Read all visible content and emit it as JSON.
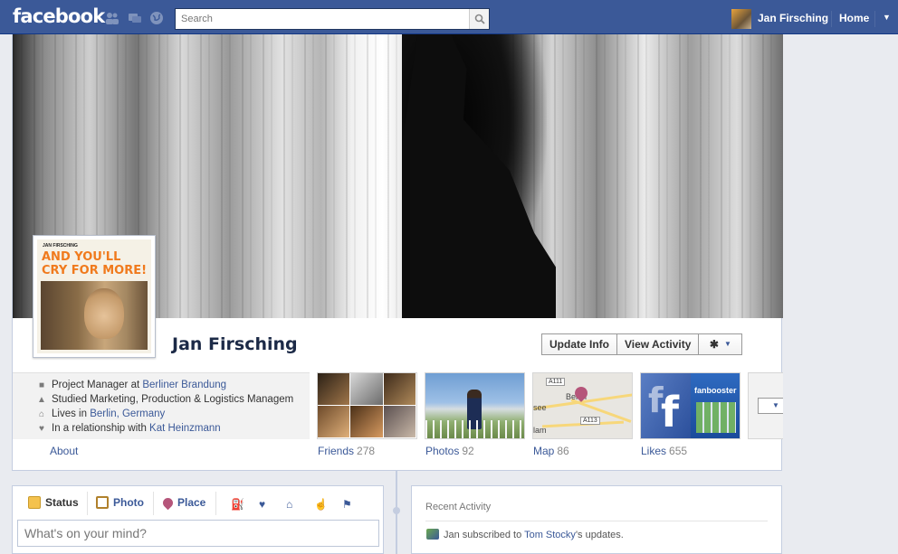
{
  "topbar": {
    "logo": "facebook",
    "search_placeholder": "Search",
    "user_name": "Jan Firsching",
    "home_label": "Home",
    "icons": [
      "friend-requests-icon",
      "messages-icon",
      "notifications-globe-icon",
      "search-icon",
      "account-caret-icon"
    ]
  },
  "profile": {
    "name": "Jan Firsching",
    "picture_text_small": "JAN FIRSCHING",
    "picture_text_big": "AND YOU'LL CRY FOR MORE!",
    "actions": {
      "update_info": "Update Info",
      "view_activity": "View Activity",
      "gear": "✱"
    }
  },
  "about": {
    "lines": [
      {
        "prefix": "Project Manager at ",
        "link": "Berliner Brandung",
        "suffix": "",
        "icon": "briefcase-icon"
      },
      {
        "prefix": "Studied Marketing, Production & Logistics Managem",
        "link": "",
        "suffix": "",
        "icon": "school-icon"
      },
      {
        "prefix": "Lives in ",
        "link": "Berlin, Germany",
        "suffix": "",
        "icon": "home-icon"
      },
      {
        "prefix": "In a relationship with ",
        "link": "Kat Heinzmann",
        "suffix": "",
        "icon": "heart-icon"
      }
    ],
    "about_link": "About"
  },
  "tiles": {
    "friends": {
      "label": "Friends",
      "count": "278"
    },
    "photos": {
      "label": "Photos",
      "count": "92"
    },
    "map": {
      "label": "Map",
      "count": "86",
      "labels": [
        "A111",
        "Berlin",
        "see",
        "A113",
        "lam"
      ]
    },
    "likes": {
      "label": "Likes",
      "count": "655",
      "fan_text": "fanbooster"
    }
  },
  "composer": {
    "tabs": [
      "Status",
      "Photo",
      "Place"
    ],
    "extra_icons": [
      "life-event-icon",
      "heart-small-icon",
      "home-small-icon",
      "hand-icon",
      "flag-icon"
    ],
    "placeholder": "What's on your mind?"
  },
  "recent_activity": {
    "title": "Recent Activity",
    "item_prefix": "Jan subscribed to ",
    "item_link": "Tom Stocky",
    "item_suffix": "'s updates."
  },
  "colors": {
    "brand": "#3b5998",
    "page_bg": "#e9ebf0",
    "picture_accent": "#f07a1d"
  }
}
